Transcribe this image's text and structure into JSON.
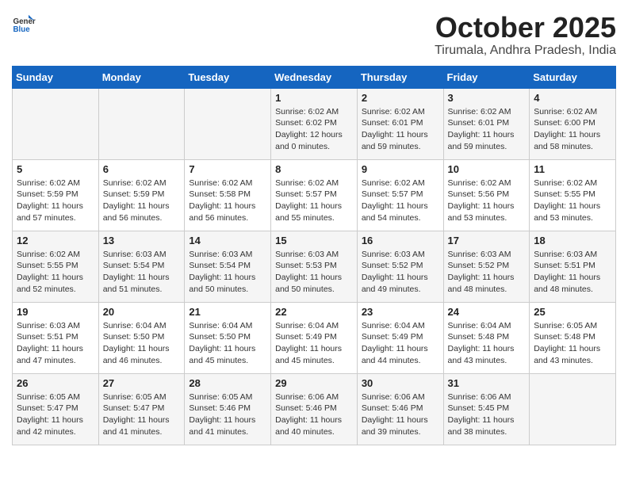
{
  "logo": {
    "text_general": "General",
    "text_blue": "Blue"
  },
  "header": {
    "month": "October 2025",
    "location": "Tirumala, Andhra Pradesh, India"
  },
  "weekdays": [
    "Sunday",
    "Monday",
    "Tuesday",
    "Wednesday",
    "Thursday",
    "Friday",
    "Saturday"
  ],
  "weeks": [
    [
      {
        "day": "",
        "sunrise": "",
        "sunset": "",
        "daylight": ""
      },
      {
        "day": "",
        "sunrise": "",
        "sunset": "",
        "daylight": ""
      },
      {
        "day": "",
        "sunrise": "",
        "sunset": "",
        "daylight": ""
      },
      {
        "day": "1",
        "sunrise": "Sunrise: 6:02 AM",
        "sunset": "Sunset: 6:02 PM",
        "daylight": "Daylight: 12 hours and 0 minutes."
      },
      {
        "day": "2",
        "sunrise": "Sunrise: 6:02 AM",
        "sunset": "Sunset: 6:01 PM",
        "daylight": "Daylight: 11 hours and 59 minutes."
      },
      {
        "day": "3",
        "sunrise": "Sunrise: 6:02 AM",
        "sunset": "Sunset: 6:01 PM",
        "daylight": "Daylight: 11 hours and 59 minutes."
      },
      {
        "day": "4",
        "sunrise": "Sunrise: 6:02 AM",
        "sunset": "Sunset: 6:00 PM",
        "daylight": "Daylight: 11 hours and 58 minutes."
      }
    ],
    [
      {
        "day": "5",
        "sunrise": "Sunrise: 6:02 AM",
        "sunset": "Sunset: 5:59 PM",
        "daylight": "Daylight: 11 hours and 57 minutes."
      },
      {
        "day": "6",
        "sunrise": "Sunrise: 6:02 AM",
        "sunset": "Sunset: 5:59 PM",
        "daylight": "Daylight: 11 hours and 56 minutes."
      },
      {
        "day": "7",
        "sunrise": "Sunrise: 6:02 AM",
        "sunset": "Sunset: 5:58 PM",
        "daylight": "Daylight: 11 hours and 56 minutes."
      },
      {
        "day": "8",
        "sunrise": "Sunrise: 6:02 AM",
        "sunset": "Sunset: 5:57 PM",
        "daylight": "Daylight: 11 hours and 55 minutes."
      },
      {
        "day": "9",
        "sunrise": "Sunrise: 6:02 AM",
        "sunset": "Sunset: 5:57 PM",
        "daylight": "Daylight: 11 hours and 54 minutes."
      },
      {
        "day": "10",
        "sunrise": "Sunrise: 6:02 AM",
        "sunset": "Sunset: 5:56 PM",
        "daylight": "Daylight: 11 hours and 53 minutes."
      },
      {
        "day": "11",
        "sunrise": "Sunrise: 6:02 AM",
        "sunset": "Sunset: 5:55 PM",
        "daylight": "Daylight: 11 hours and 53 minutes."
      }
    ],
    [
      {
        "day": "12",
        "sunrise": "Sunrise: 6:02 AM",
        "sunset": "Sunset: 5:55 PM",
        "daylight": "Daylight: 11 hours and 52 minutes."
      },
      {
        "day": "13",
        "sunrise": "Sunrise: 6:03 AM",
        "sunset": "Sunset: 5:54 PM",
        "daylight": "Daylight: 11 hours and 51 minutes."
      },
      {
        "day": "14",
        "sunrise": "Sunrise: 6:03 AM",
        "sunset": "Sunset: 5:54 PM",
        "daylight": "Daylight: 11 hours and 50 minutes."
      },
      {
        "day": "15",
        "sunrise": "Sunrise: 6:03 AM",
        "sunset": "Sunset: 5:53 PM",
        "daylight": "Daylight: 11 hours and 50 minutes."
      },
      {
        "day": "16",
        "sunrise": "Sunrise: 6:03 AM",
        "sunset": "Sunset: 5:52 PM",
        "daylight": "Daylight: 11 hours and 49 minutes."
      },
      {
        "day": "17",
        "sunrise": "Sunrise: 6:03 AM",
        "sunset": "Sunset: 5:52 PM",
        "daylight": "Daylight: 11 hours and 48 minutes."
      },
      {
        "day": "18",
        "sunrise": "Sunrise: 6:03 AM",
        "sunset": "Sunset: 5:51 PM",
        "daylight": "Daylight: 11 hours and 48 minutes."
      }
    ],
    [
      {
        "day": "19",
        "sunrise": "Sunrise: 6:03 AM",
        "sunset": "Sunset: 5:51 PM",
        "daylight": "Daylight: 11 hours and 47 minutes."
      },
      {
        "day": "20",
        "sunrise": "Sunrise: 6:04 AM",
        "sunset": "Sunset: 5:50 PM",
        "daylight": "Daylight: 11 hours and 46 minutes."
      },
      {
        "day": "21",
        "sunrise": "Sunrise: 6:04 AM",
        "sunset": "Sunset: 5:50 PM",
        "daylight": "Daylight: 11 hours and 45 minutes."
      },
      {
        "day": "22",
        "sunrise": "Sunrise: 6:04 AM",
        "sunset": "Sunset: 5:49 PM",
        "daylight": "Daylight: 11 hours and 45 minutes."
      },
      {
        "day": "23",
        "sunrise": "Sunrise: 6:04 AM",
        "sunset": "Sunset: 5:49 PM",
        "daylight": "Daylight: 11 hours and 44 minutes."
      },
      {
        "day": "24",
        "sunrise": "Sunrise: 6:04 AM",
        "sunset": "Sunset: 5:48 PM",
        "daylight": "Daylight: 11 hours and 43 minutes."
      },
      {
        "day": "25",
        "sunrise": "Sunrise: 6:05 AM",
        "sunset": "Sunset: 5:48 PM",
        "daylight": "Daylight: 11 hours and 43 minutes."
      }
    ],
    [
      {
        "day": "26",
        "sunrise": "Sunrise: 6:05 AM",
        "sunset": "Sunset: 5:47 PM",
        "daylight": "Daylight: 11 hours and 42 minutes."
      },
      {
        "day": "27",
        "sunrise": "Sunrise: 6:05 AM",
        "sunset": "Sunset: 5:47 PM",
        "daylight": "Daylight: 11 hours and 41 minutes."
      },
      {
        "day": "28",
        "sunrise": "Sunrise: 6:05 AM",
        "sunset": "Sunset: 5:46 PM",
        "daylight": "Daylight: 11 hours and 41 minutes."
      },
      {
        "day": "29",
        "sunrise": "Sunrise: 6:06 AM",
        "sunset": "Sunset: 5:46 PM",
        "daylight": "Daylight: 11 hours and 40 minutes."
      },
      {
        "day": "30",
        "sunrise": "Sunrise: 6:06 AM",
        "sunset": "Sunset: 5:46 PM",
        "daylight": "Daylight: 11 hours and 39 minutes."
      },
      {
        "day": "31",
        "sunrise": "Sunrise: 6:06 AM",
        "sunset": "Sunset: 5:45 PM",
        "daylight": "Daylight: 11 hours and 38 minutes."
      },
      {
        "day": "",
        "sunrise": "",
        "sunset": "",
        "daylight": ""
      }
    ]
  ]
}
